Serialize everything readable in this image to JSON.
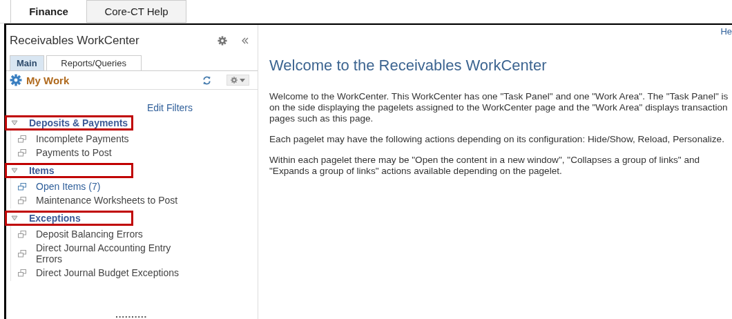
{
  "top_tabs": [
    {
      "label": "Finance",
      "selected": true
    },
    {
      "label": "Core-CT Help",
      "selected": false
    }
  ],
  "panel": {
    "title": "Receivables WorkCenter",
    "tabs": [
      {
        "label": "Main",
        "selected": true
      },
      {
        "label": "Reports/Queries",
        "selected": false
      }
    ],
    "pagelet": {
      "title": "My Work",
      "edit_filters": "Edit Filters",
      "groups": [
        {
          "title": "Deposits & Payments",
          "expanded": true,
          "highlighted": true,
          "items": [
            {
              "label": "Incomplete Payments",
              "visited": false
            },
            {
              "label": "Payments to Post",
              "visited": false
            }
          ]
        },
        {
          "title": "Items",
          "expanded": true,
          "highlighted": true,
          "items": [
            {
              "label": "Open Items (7)",
              "visited": true
            },
            {
              "label": "Maintenance Worksheets to Post",
              "visited": false
            }
          ]
        },
        {
          "title": "Exceptions",
          "expanded": true,
          "highlighted": true,
          "items": [
            {
              "label": "Deposit Balancing Errors",
              "visited": false
            },
            {
              "label": "Direct Journal Accounting Entry Errors",
              "visited": false
            },
            {
              "label": "Direct Journal Budget Exceptions",
              "visited": false
            }
          ]
        }
      ]
    }
  },
  "work_area": {
    "corner_link": "He",
    "heading": "Welcome to the Receivables WorkCenter",
    "paragraphs": [
      "Welcome to the WorkCenter. This WorkCenter has one \"Task Panel\" and one \"Work Area\". The \"Task Panel\" is on the side displaying the pagelets assigned to the WorkCenter page and the \"Work Area\" displays transaction pages such as this page.",
      "Each pagelet may have the following actions depending on its configuration: Hide/Show, Reload, Personalize.",
      "Within each pagelet there may be \"Open the content in a new window\", \"Collapses a group of links\" and \"Expands a group of links\" actions available depending on the pagelet."
    ]
  }
}
